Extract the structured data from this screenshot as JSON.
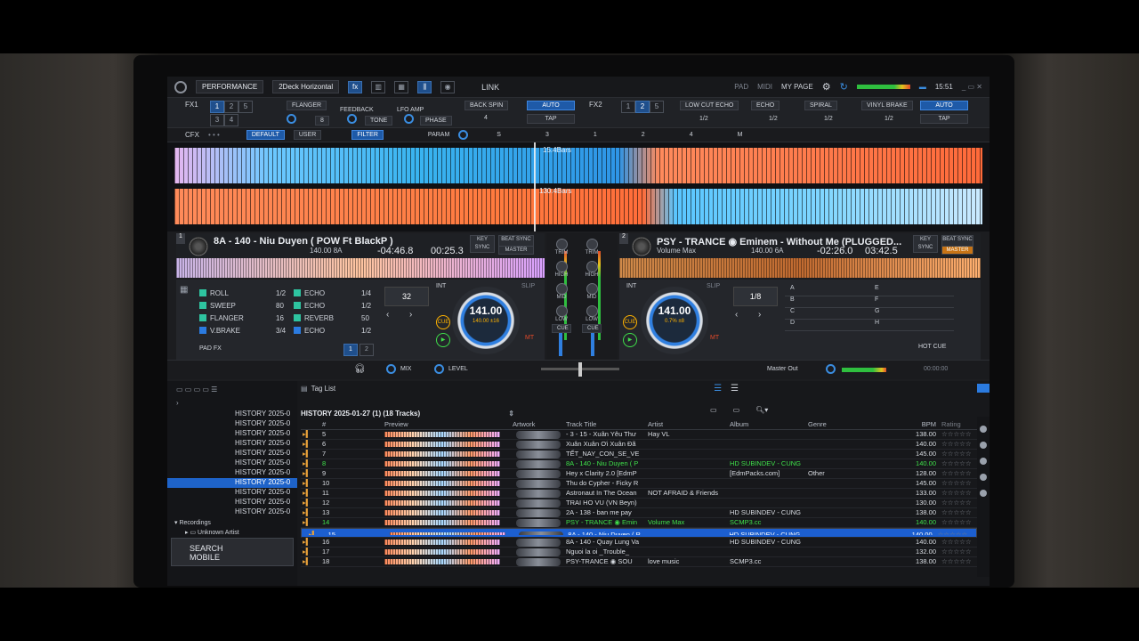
{
  "topbar": {
    "layout": "PERFORMANCE",
    "deck_layout": "2Deck Horizontal",
    "link": "LINK",
    "pad": "PAD",
    "midi": "MIDI",
    "my_page": "MY PAGE",
    "clock": "15:51"
  },
  "fx1": {
    "label": "FX1",
    "beats": [
      "1",
      "2",
      "3",
      "4",
      "5"
    ],
    "effect": "FLANGER",
    "feedback": "FEEDBACK",
    "lfo_amp": "LFO AMP",
    "tone": "TONE",
    "phase": "PHASE",
    "value_8": "8",
    "value_4": "4",
    "back_spin": "BACK SPIN",
    "auto": "AUTO",
    "tap": "TAP"
  },
  "fx2": {
    "label": "FX2",
    "effect1": "LOW CUT ECHO",
    "effect2": "ECHO",
    "effect3": "SPIRAL",
    "effect4": "VINYL BRAKE",
    "half": "1/2",
    "auto": "AUTO",
    "tap": "TAP"
  },
  "cfx": {
    "label": "CFX",
    "mode1": "DEFAULT",
    "mode2": "USER",
    "filter": "FILTER",
    "param": "PARAM",
    "s": "S",
    "n3": "3",
    "n1": "1",
    "n2": "2",
    "n4": "4",
    "m": "M"
  },
  "waveform": {
    "bars_top": "15.4Bars",
    "bars_bottom": "130.4Bars"
  },
  "deck1": {
    "number": "1",
    "title": "8A - 140 - Niu Duyen ( POW Ft BlackP )",
    "bpm_key": "140.00 8A",
    "remaining": "-04:46.8",
    "elapsed": "00:25.3",
    "key_sync": "KEY SYNC",
    "beat_sync": "BEAT SYNC",
    "master": "MASTER",
    "fx_slots": [
      {
        "name": "ROLL",
        "value": "1/2"
      },
      {
        "name": "SWEEP",
        "value": "80"
      },
      {
        "name": "FLANGER",
        "value": "16"
      },
      {
        "name": "V.BRAKE",
        "value": "3/4"
      }
    ],
    "fx_slots_right": [
      {
        "name": "ECHO",
        "value": "1/4"
      },
      {
        "name": "ECHO",
        "value": "1/2"
      },
      {
        "name": "REVERB",
        "value": "50"
      },
      {
        "name": "ECHO",
        "value": "1/2"
      }
    ],
    "loop": "32",
    "int": "INT",
    "slip": "SLIP",
    "bpm": "141.00",
    "bpm_sub": "140.00  ±16",
    "cue": "CUE",
    "mt": "MT",
    "pad_fx": "PAD FX",
    "page1": "1",
    "page2": "2"
  },
  "deck2": {
    "number": "2",
    "title": "PSY - TRANCE ◉ Eminem - Without Me (PLUGGED...",
    "subtitle": "Volume Max",
    "bpm_key": "140.00 6A",
    "remaining": "-02:26.0",
    "elapsed": "03:42.5",
    "key_sync": "KEY SYNC",
    "beat_sync": "BEAT SYNC",
    "master": "MASTER",
    "loop": "1/8",
    "int": "INT",
    "slip": "SLIP",
    "bpm": "141.00",
    "bpm_sub": "0.7%  ±8",
    "cue": "CUE",
    "mt": "MT",
    "hot_cue": "HOT CUE",
    "pads": [
      "A",
      "B",
      "C",
      "D",
      "E",
      "F",
      "G",
      "H"
    ]
  },
  "mixer": {
    "trim": "TRIM",
    "high": "HIGH",
    "mid": "MID",
    "low": "LOW",
    "cue": "CUE"
  },
  "strip": {
    "mix": "MIX",
    "level": "LEVEL",
    "master_out": "Master Out",
    "time": "00:00:00"
  },
  "browser": {
    "tag_list": "Tag List",
    "history_title": "HISTORY 2025-01-27 (1) (18 Tracks)",
    "tree": [
      {
        "label": "HISTORY 2025-0",
        "active": false
      },
      {
        "label": "HISTORY 2025-0",
        "active": false
      },
      {
        "label": "HISTORY 2025-0",
        "active": false
      },
      {
        "label": "HISTORY 2025-0",
        "active": false
      },
      {
        "label": "HISTORY 2025-0",
        "active": false
      },
      {
        "label": "HISTORY 2025-0",
        "active": false
      },
      {
        "label": "HISTORY 2025-0",
        "active": false
      },
      {
        "label": "HISTORY 2025-0",
        "active": true
      },
      {
        "label": "HISTORY 2025-0",
        "active": false
      },
      {
        "label": "HISTORY 2025-0",
        "active": false
      },
      {
        "label": "HISTORY 2025-0",
        "active": false
      }
    ],
    "recordings": "Recordings",
    "unknown_artist": "Unknown Artist",
    "search_mobile_1": "SEARCH",
    "search_mobile_2": "MOBILE",
    "columns": {
      "preview": "Preview",
      "artwork": "Artwork",
      "title": "Track Title",
      "artist": "Artist",
      "album": "Album",
      "genre": "Genre",
      "bpm": "BPM",
      "rating": "Rating"
    },
    "rows": [
      {
        "no": "5",
        "title": "- 3 - 15 - Xuân Yêu Thư",
        "artist": "Hay VL",
        "album": "",
        "genre": "",
        "bpm": "138.00",
        "style": ""
      },
      {
        "no": "6",
        "title": "Xuân Xuân Ơi Xuân Đã",
        "artist": "",
        "album": "",
        "genre": "",
        "bpm": "140.00",
        "style": ""
      },
      {
        "no": "7",
        "title": "TẾT_NAY_CON_SE_VE",
        "artist": "",
        "album": "",
        "genre": "",
        "bpm": "145.00",
        "style": ""
      },
      {
        "no": "8",
        "title": "8A - 140 - Niu Duyen ( P",
        "artist": "",
        "album": "HD SUBINDEV - CUNG",
        "genre": "",
        "bpm": "140.00",
        "style": "green"
      },
      {
        "no": "9",
        "title": "Hey x Clarity 2.0 [EdmP",
        "artist": "",
        "album": "[EdmPacks.com]",
        "genre": "Other",
        "bpm": "128.00",
        "style": ""
      },
      {
        "no": "10",
        "title": "Thu do Cypher - Ficky R",
        "artist": "",
        "album": "",
        "genre": "",
        "bpm": "145.00",
        "style": ""
      },
      {
        "no": "11",
        "title": "Astronaut In The Ocean",
        "artist": "NOT AFRAID & Friends",
        "album": "",
        "genre": "",
        "bpm": "133.00",
        "style": ""
      },
      {
        "no": "12",
        "title": "TRAI HO VU (VN Beyn)",
        "artist": "",
        "album": "",
        "genre": "",
        "bpm": "130.00",
        "style": ""
      },
      {
        "no": "13",
        "title": "2A - 138 - ban me pay",
        "artist": "",
        "album": "HD SUBINDEV - CUNG",
        "genre": "",
        "bpm": "138.00",
        "style": ""
      },
      {
        "no": "14",
        "title": "PSY - TRANCE ◉ Emin",
        "artist": "Volume Max",
        "album": "SCMP3.cc",
        "genre": "",
        "bpm": "140.00",
        "style": "green"
      },
      {
        "no": "15",
        "title": "8A - 140 - Niu Duyen ( P",
        "artist": "",
        "album": "HD SUBINDEV - CUNG",
        "genre": "",
        "bpm": "140.00",
        "style": "sel"
      },
      {
        "no": "16",
        "title": "8A - 140 - Quay Lung Va",
        "artist": "",
        "album": "HD SUBINDEV - CUNG",
        "genre": "",
        "bpm": "140.00",
        "style": ""
      },
      {
        "no": "17",
        "title": "Nguoi la oi _Trouble_",
        "artist": "",
        "album": "",
        "genre": "",
        "bpm": "132.00",
        "style": ""
      },
      {
        "no": "18",
        "title": "PSY-TRANCE ◉ SOU",
        "artist": "love music",
        "album": "SCMP3.cc",
        "genre": "",
        "bpm": "138.00",
        "style": ""
      }
    ]
  }
}
